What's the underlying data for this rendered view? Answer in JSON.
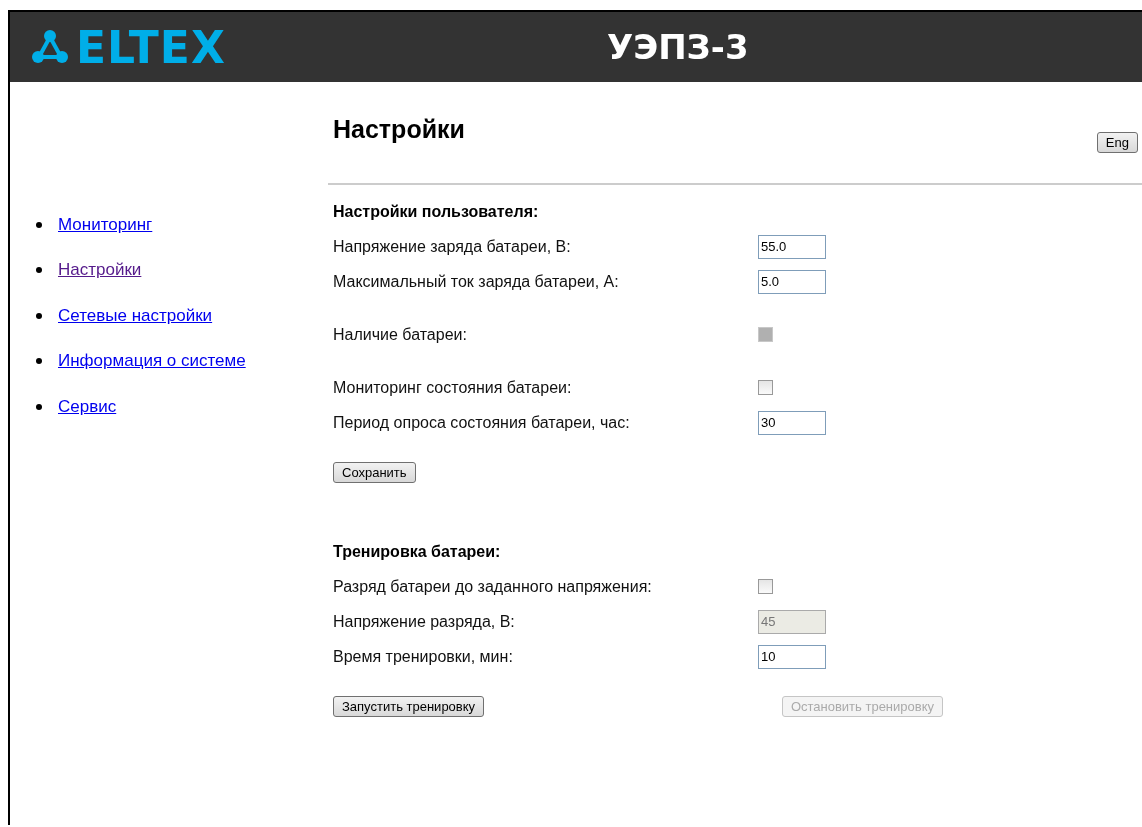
{
  "header": {
    "logo_text": "ELTEX",
    "title": "УЭПЗ-3"
  },
  "nav": [
    {
      "label": "Мониторинг",
      "selected": false
    },
    {
      "label": "Настройки",
      "selected": true
    },
    {
      "label": "Сетевые настройки",
      "selected": false
    },
    {
      "label": "Информация о системе",
      "selected": false
    },
    {
      "label": "Сервис",
      "selected": false
    }
  ],
  "page_title": "Настройки",
  "lang_button": "Eng",
  "sections": [
    {
      "heading": "Настройки пользователя:",
      "groups": [
        [
          {
            "label": "Напряжение заряда батареи, В:",
            "kind": "input",
            "value": "55.0",
            "disabled": false
          },
          {
            "label": "Максимальный ток заряда батареи, А:",
            "kind": "input",
            "value": "5.0",
            "disabled": false
          }
        ],
        [
          {
            "label": "Наличие батареи:",
            "kind": "checkbox",
            "checked": false,
            "disabled": true
          }
        ],
        [
          {
            "label": "Мониторинг состояния батареи:",
            "kind": "checkbox",
            "checked": false,
            "disabled": false
          },
          {
            "label": "Период опроса состояния батареи, час:",
            "kind": "input",
            "value": "30",
            "disabled": false
          }
        ]
      ],
      "buttons": [
        {
          "label": "Сохранить",
          "disabled": false
        }
      ]
    },
    {
      "heading": "Тренировка батареи:",
      "groups": [
        [
          {
            "label": "Разряд батареи до заданного напряжения:",
            "kind": "checkbox",
            "checked": false,
            "disabled": false
          },
          {
            "label": "Напряжение разряда, В:",
            "kind": "input",
            "value": "45",
            "disabled": true
          },
          {
            "label": "Время тренировки, мин:",
            "kind": "input",
            "value": "10",
            "disabled": false
          }
        ]
      ],
      "buttons": [
        {
          "label": "Запустить тренировку",
          "disabled": false
        },
        {
          "label": "Остановить тренировку",
          "disabled": true
        }
      ]
    }
  ]
}
